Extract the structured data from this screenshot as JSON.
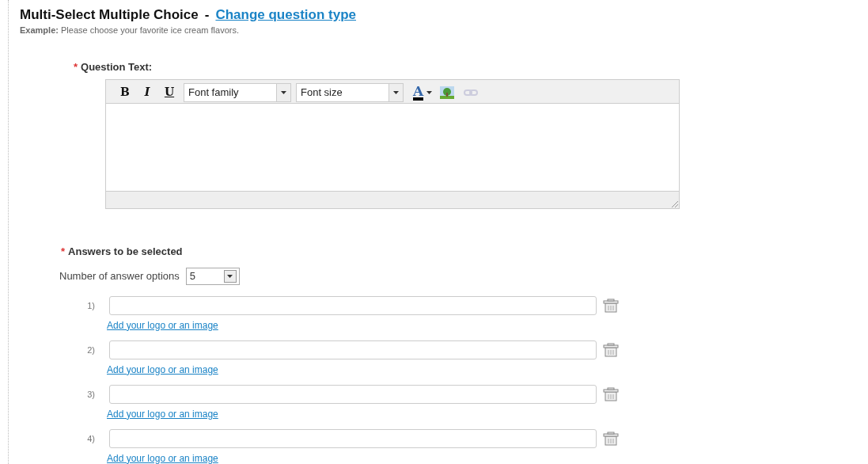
{
  "header": {
    "title": "Multi-Select Multiple Choice",
    "separator": "-",
    "link": "Change question type",
    "example_label": "Example:",
    "example_text": "Please choose your favorite ice cream flavors."
  },
  "question": {
    "required_mark": "*",
    "label": "Question Text:",
    "toolbar": [
      {
        "kind": "format",
        "label": "B"
      },
      {
        "kind": "format",
        "label": "I"
      },
      {
        "kind": "format",
        "label": "U"
      },
      {
        "kind": "select",
        "label": "Font family"
      },
      {
        "kind": "select",
        "label": "Font size"
      },
      {
        "kind": "color",
        "label": "A"
      },
      {
        "kind": "image"
      },
      {
        "kind": "link",
        "disabled": true
      }
    ]
  },
  "answers": {
    "required_mark": "*",
    "label": "Answers to be selected",
    "count_label": "Number of answer options",
    "count_value": "5",
    "items": [
      {
        "number": "1)",
        "link": "Add your logo or an image"
      },
      {
        "number": "2)",
        "link": "Add your logo or an image"
      },
      {
        "number": "3)",
        "link": "Add your logo or an image"
      },
      {
        "number": "4)",
        "link": "Add your logo or an image"
      }
    ]
  }
}
